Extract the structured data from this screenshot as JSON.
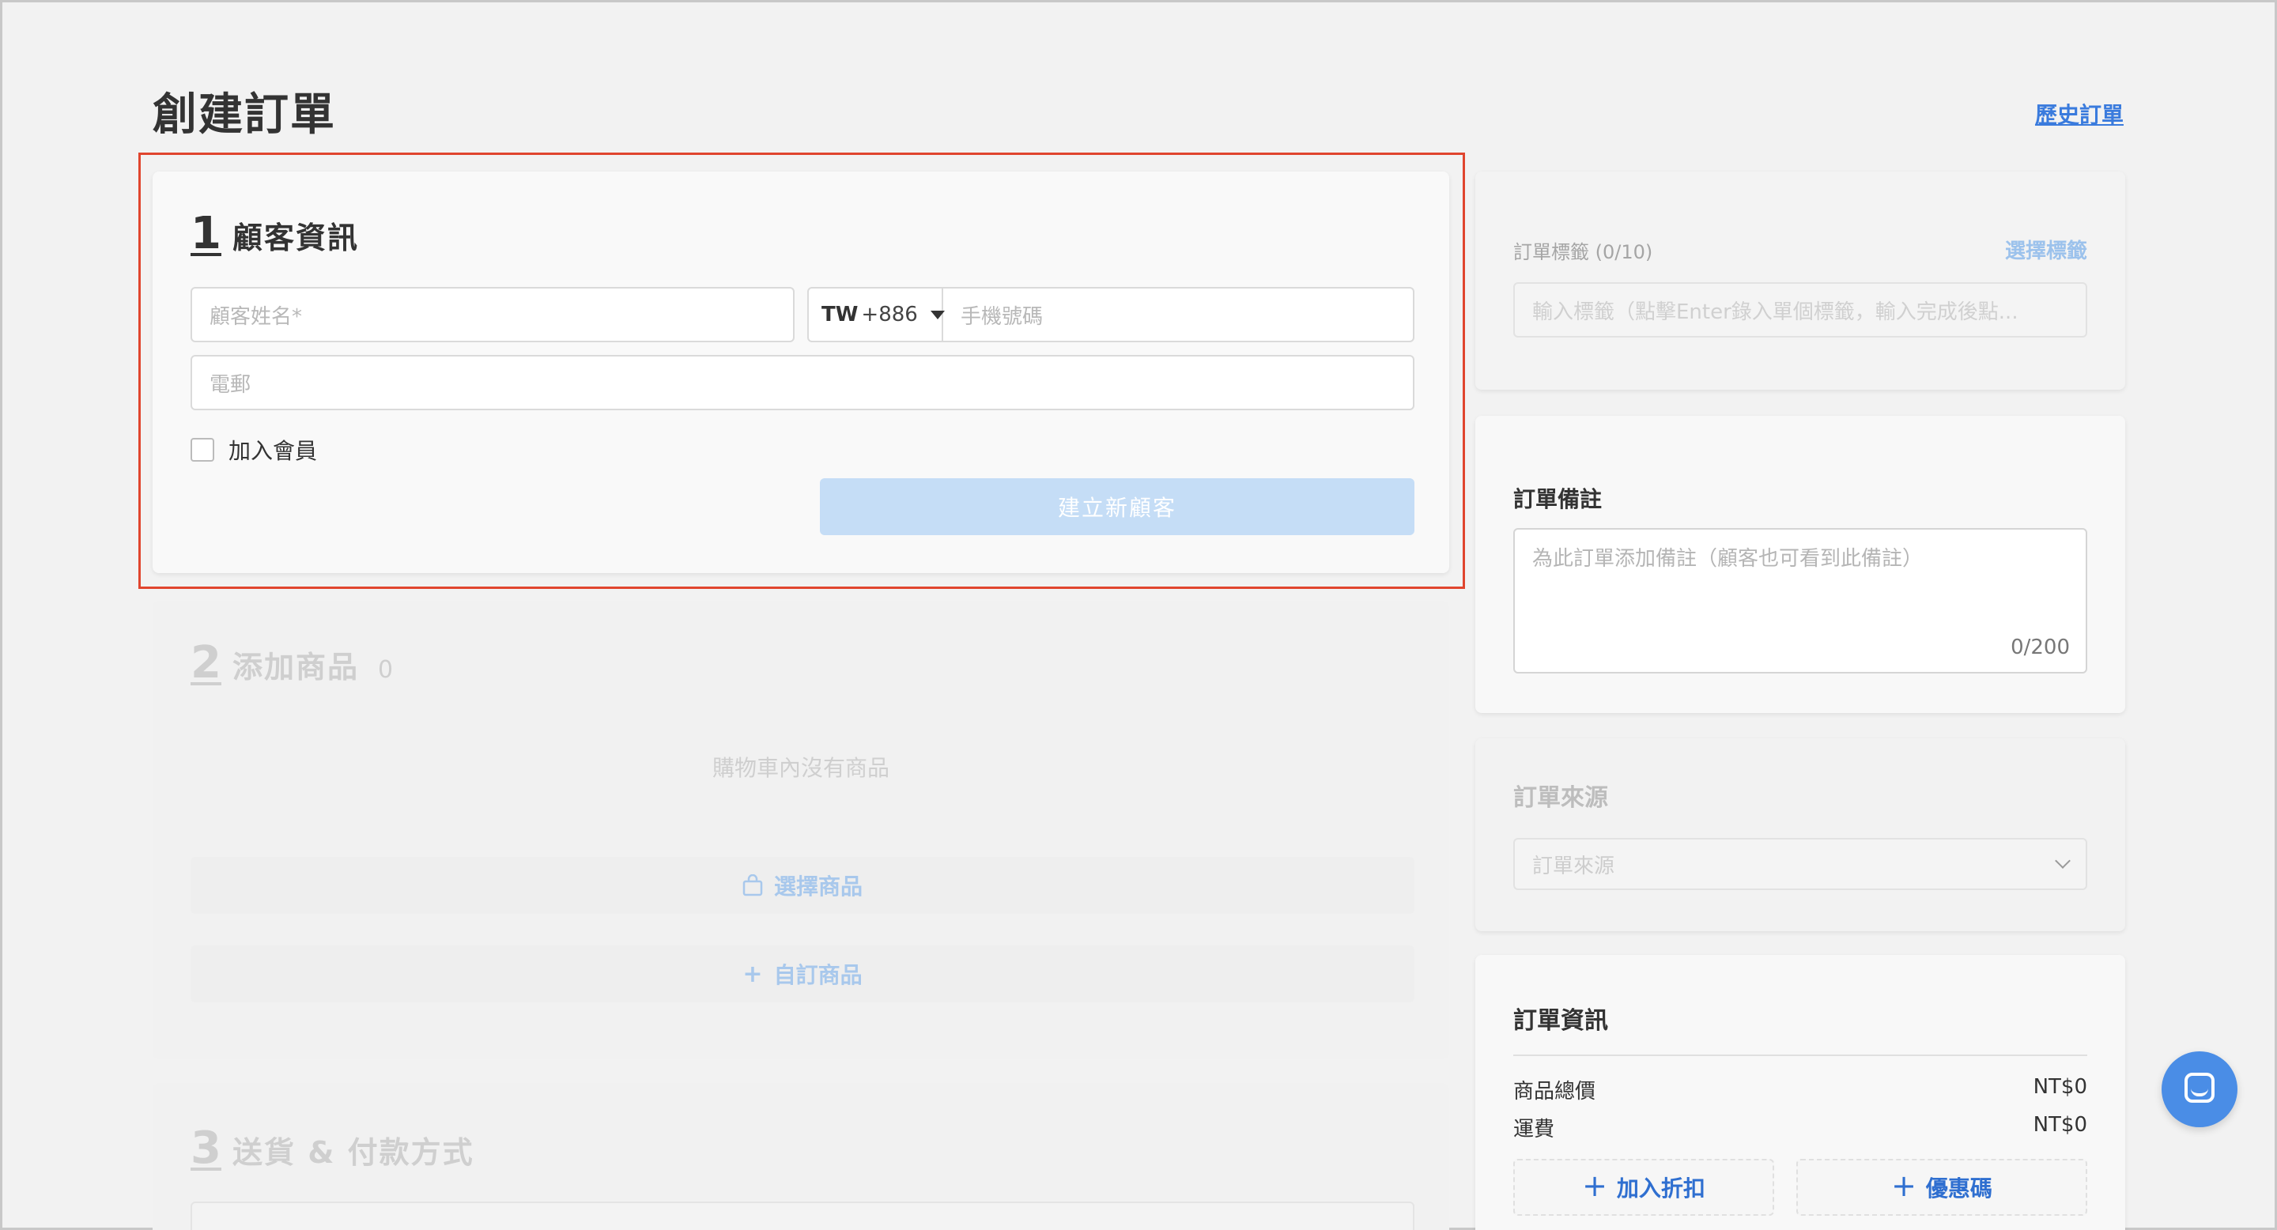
{
  "page": {
    "title": "創建訂單",
    "history_link": "歷史訂單"
  },
  "customer": {
    "step": "1",
    "heading": "顧客資訊",
    "name_placeholder": "顧客姓名*",
    "country_code": "TW",
    "dial_code": "+886",
    "phone_placeholder": "手機號碼",
    "email_placeholder": "電郵",
    "member_label": "加入會員",
    "member_checked": false,
    "create_button": "建立新顧客"
  },
  "products": {
    "step": "2",
    "heading": "添加商品",
    "count": "0",
    "empty_text": "購物車內沒有商品",
    "select_button": "選擇商品",
    "custom_button": "自訂商品"
  },
  "shipping": {
    "step": "3",
    "heading": "送貨 & 付款方式"
  },
  "tags": {
    "label": "訂單標籤 (0/10)",
    "pick_link": "選擇標籤",
    "input_placeholder": "輸入標籤（點擊Enter錄入單個標籤，輸入完成後點..."
  },
  "notes": {
    "title": "訂單備註",
    "placeholder": "為此訂單添加備註（顧客也可看到此備註）",
    "counter": "0/200"
  },
  "source": {
    "title": "訂單來源",
    "select_placeholder": "訂單來源"
  },
  "order_info": {
    "title": "訂單資訊",
    "rows": [
      {
        "label": "商品總價",
        "value": "NT$0"
      },
      {
        "label": "運費",
        "value": "NT$0"
      }
    ],
    "discount_button": "加入折扣",
    "coupon_button": "優惠碼"
  },
  "colors": {
    "accent": "#3a7bdd",
    "highlight_border": "#e0452e",
    "chat_button": "#4a8de6"
  },
  "icons": {
    "select_products": "shopping-bag-icon",
    "custom_product": "plus-icon",
    "chat": "chat-icon"
  }
}
